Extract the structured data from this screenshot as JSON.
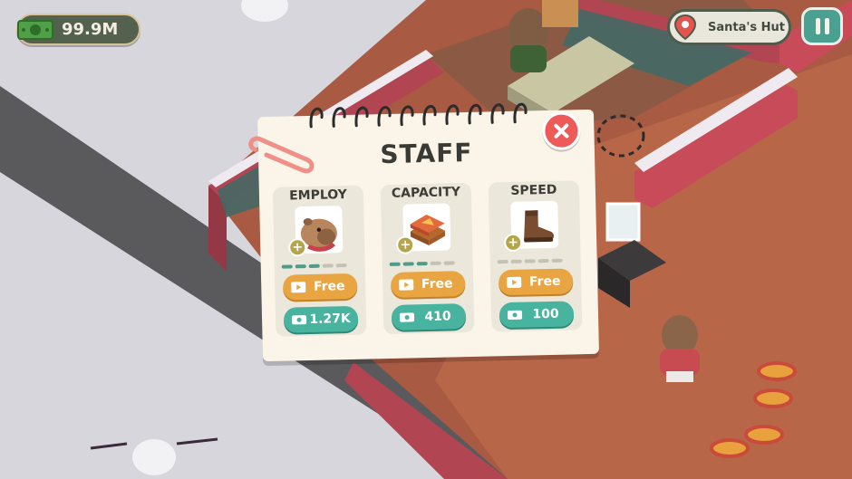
{
  "hud": {
    "money": "99.9M",
    "location": "Santa's Hut"
  },
  "dialog": {
    "title": "STAFF",
    "upgrades": [
      {
        "label": "EMPLOY",
        "icon": "capybara-icon",
        "level": 3,
        "max_level": 5,
        "free_label": "Free",
        "cost": "1.27K"
      },
      {
        "label": "CAPACITY",
        "icon": "pizza-box-icon",
        "level": 3,
        "max_level": 5,
        "free_label": "Free",
        "cost": "410"
      },
      {
        "label": "SPEED",
        "icon": "boot-icon",
        "level": 0,
        "max_level": 5,
        "free_label": "Free",
        "cost": "100"
      }
    ]
  },
  "colors": {
    "close": "#ee5a58",
    "free_button": "#e8a541",
    "cost_button": "#48b39e",
    "pause_button": "#4aa191"
  }
}
